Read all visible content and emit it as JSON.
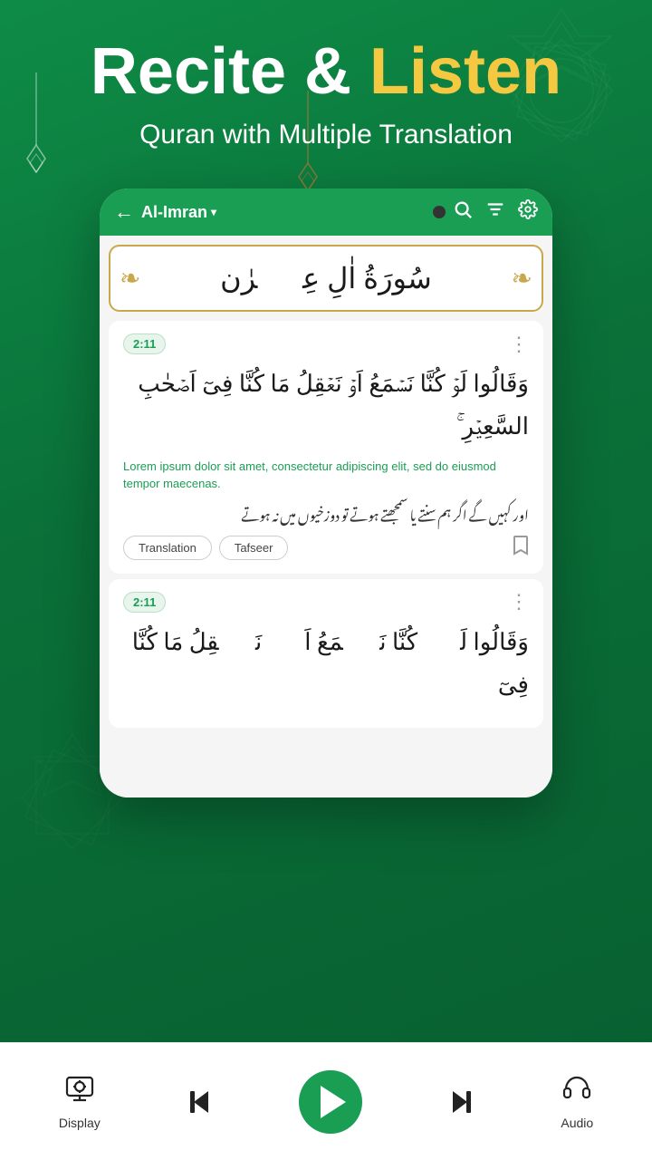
{
  "hero": {
    "title_part1": "Recite & ",
    "title_listen": "Listen",
    "subtitle": "Quran with Multiple Translation"
  },
  "topbar": {
    "back_label": "←",
    "surah_name": "Al-Imran",
    "chevron": "▾",
    "search_icon": "search",
    "filter_icon": "filter",
    "settings_icon": "gear"
  },
  "surah_header": {
    "arabic": "سُورَةُ اٰلِ عِمۡرٰن"
  },
  "verses": [
    {
      "number": "2:11",
      "arabic": "وَقَالُوا لَوۡ كُنَّا نَسۡمَعُ اَوۡ نَعۡقِلُ مَا كُنَّا فِىٓ اَصۡحٰبِ السَّعِيۡرِ ۚ",
      "translation_en": "Lorem ipsum dolor sit amet, consectetur adipiscing elit, sed do eiusmod tempor maecenas.",
      "translation_ur": "اور کہیں گے اگر ہم سنتے یا سمجھتے ہوتے تو دوزخیوں میں نہ ہوتے",
      "tag1": "Translation",
      "tag2": "Tafseer"
    },
    {
      "number": "2:11",
      "arabic": "وَقَالُوا لَوۡ كُنَّا نَسۡمَعُ اَوۡ نَعۡقِلُ مَا كُنَّا فِىٓ",
      "translation_en": "",
      "translation_ur": "",
      "tag1": "",
      "tag2": ""
    }
  ],
  "bottom_bar": {
    "display_label": "Display",
    "audio_label": "Audio",
    "prev_icon": "prev",
    "play_icon": "play",
    "next_icon": "next",
    "display_icon": "display",
    "headphone_icon": "headphone"
  },
  "colors": {
    "green": "#1a9e54",
    "yellow": "#f5c842",
    "bg_green": "#0a7a3e"
  }
}
